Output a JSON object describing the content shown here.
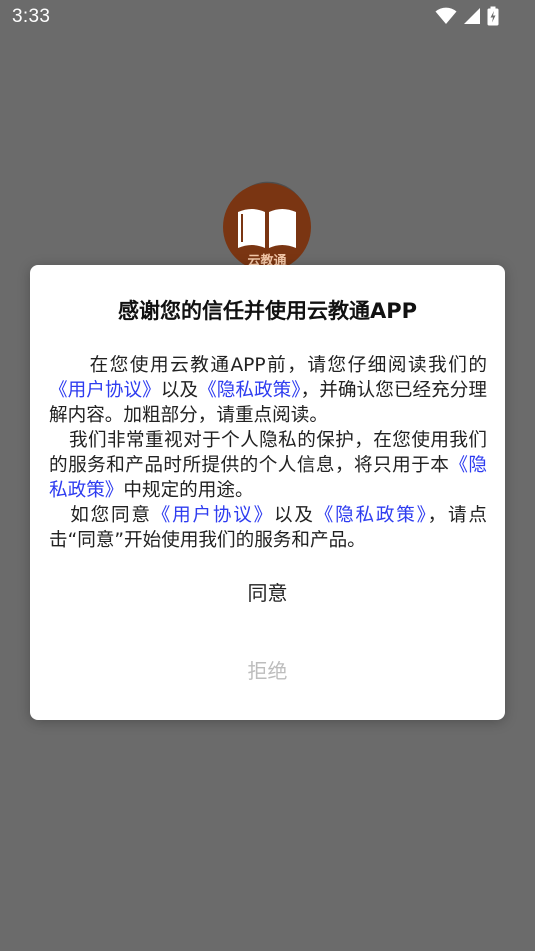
{
  "status_bar": {
    "time": "3:33",
    "icons": [
      "wifi-icon",
      "signal-icon",
      "battery-charging-icon"
    ]
  },
  "app": {
    "logo_text": "云教通",
    "brand_color": "#7a3512"
  },
  "dialog": {
    "title": "感谢您的信任并使用云教通APP",
    "p1_a": "在您使用云教通APP前，请您仔细阅读我们的",
    "p1_link1": "《用户协议》",
    "p1_b": "以及",
    "p1_link2": "《隐私政策》",
    "p1_c": "，并确认您已经充分理解内容。加粗部分，请重点阅读。",
    "p2_a": "我们非常重视对于个人隐私的保护，在您使用我们的服务和产品时所提供的个人信息，将只用于本",
    "p2_link": "《隐私政策》",
    "p2_b": "中规定的用途。",
    "p3_a": "如您同意",
    "p3_link1": "《用户协议》",
    "p3_b": "以及",
    "p3_link2": "《隐私政策》",
    "p3_c": "，请点击“同意”开始使用我们的服务和产品。",
    "agree_label": "同意",
    "reject_label": "拒绝",
    "link_color": "#2e3cf0"
  }
}
